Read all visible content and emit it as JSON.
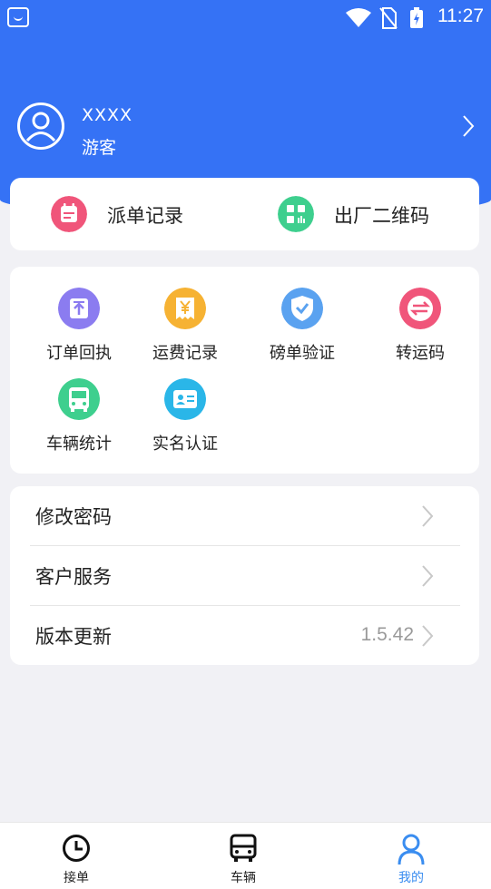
{
  "status_bar": {
    "time": "11:27"
  },
  "profile": {
    "name": "XXXX",
    "role": "游客"
  },
  "quick_actions": [
    {
      "label": "派单记录",
      "icon": "calendar-icon",
      "color": "#f0557a"
    },
    {
      "label": "出厂二维码",
      "icon": "qr-grid-icon",
      "color": "#3ecf8e"
    }
  ],
  "features": [
    {
      "label": "订单回执",
      "icon": "upload-receipt-icon",
      "color": "#8b7cf0"
    },
    {
      "label": "运费记录",
      "icon": "yen-receipt-icon",
      "color": "#f6b233"
    },
    {
      "label": "磅单验证",
      "icon": "shield-check-icon",
      "color": "#5aa2f0"
    },
    {
      "label": "转运码",
      "icon": "swap-arrows-icon",
      "color": "#f0557a"
    },
    {
      "label": "车辆统计",
      "icon": "bus-icon",
      "color": "#3ecf8e"
    },
    {
      "label": "实名认证",
      "icon": "id-card-icon",
      "color": "#2ab6e8"
    }
  ],
  "settings": [
    {
      "label": "修改密码",
      "value": ""
    },
    {
      "label": "客户服务",
      "value": ""
    },
    {
      "label": "版本更新",
      "value": "1.5.42"
    }
  ],
  "tabs": [
    {
      "label": "接单",
      "icon": "clock-icon",
      "active": false
    },
    {
      "label": "车辆",
      "icon": "bus-icon",
      "active": false
    },
    {
      "label": "我的",
      "icon": "person-icon",
      "active": true
    }
  ],
  "colors": {
    "brand": "#3572f5",
    "active_tab": "#3a8df0",
    "background": "#f1f1f5"
  }
}
